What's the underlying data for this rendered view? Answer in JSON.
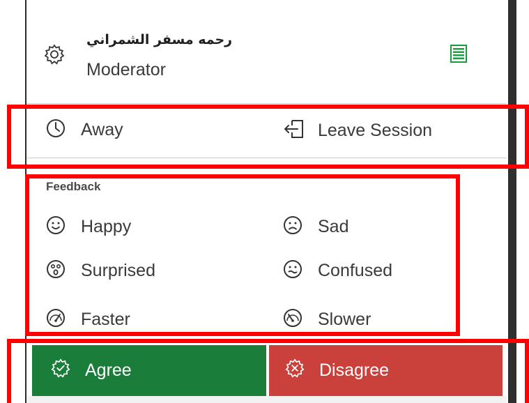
{
  "user": {
    "name": "رحمه مسفر الشمراني",
    "role": "Moderator"
  },
  "status": {
    "away_label": "Away",
    "leave_label": "Leave Session"
  },
  "feedback": {
    "title": "Feedback",
    "items": [
      {
        "label": "Happy",
        "icon": "happy-face-icon"
      },
      {
        "label": "Sad",
        "icon": "sad-face-icon"
      },
      {
        "label": "Surprised",
        "icon": "surprised-face-icon"
      },
      {
        "label": "Confused",
        "icon": "confused-face-icon"
      },
      {
        "label": "Faster",
        "icon": "faster-gauge-icon"
      },
      {
        "label": "Slower",
        "icon": "slower-gauge-icon"
      }
    ]
  },
  "actions": {
    "agree_label": "Agree",
    "disagree_label": "Disagree"
  },
  "colors": {
    "agree": "#1a7d3a",
    "disagree": "#c9413a",
    "annotation": "#ff0000",
    "list_icon": "#1a9a3a"
  }
}
